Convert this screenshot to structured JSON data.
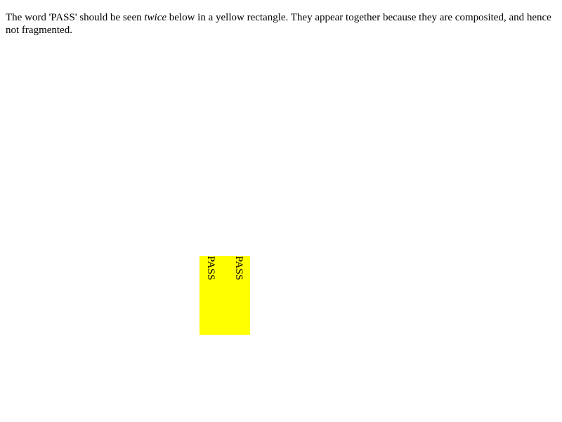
{
  "intro": {
    "part1": "The word 'PASS' should be seen ",
    "emphasis": "twice",
    "part2": " below in a yellow rectangle. They appear together because they are composited, and hence not fragmented."
  },
  "box": {
    "color": "#ffff00",
    "words": [
      "PASS",
      "PASS"
    ]
  }
}
